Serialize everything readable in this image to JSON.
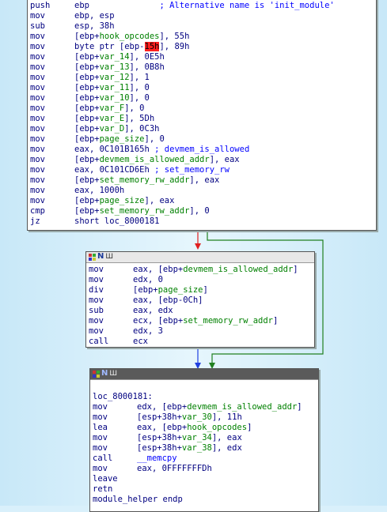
{
  "block1": {
    "lines": [
      {
        "m": "push",
        "parts": [
          {
            "t": "ebp",
            "c": "op"
          },
          {
            "t": "              ; Alternative name is 'init_module'",
            "c": "cmt"
          }
        ]
      },
      {
        "m": "mov",
        "parts": [
          {
            "t": "ebp, esp",
            "c": "op"
          }
        ]
      },
      {
        "m": "sub",
        "parts": [
          {
            "t": "esp, 38h",
            "c": "op"
          }
        ]
      },
      {
        "m": "mov",
        "parts": [
          {
            "t": "[ebp+",
            "c": "op"
          },
          {
            "t": "hook_opcodes",
            "c": "var"
          },
          {
            "t": "], 55h",
            "c": "op"
          }
        ]
      },
      {
        "m": "mov",
        "parts": [
          {
            "t": "byte ptr [ebp-",
            "c": "op"
          },
          {
            "t": "15h",
            "c": "hl"
          },
          {
            "t": "], 89h",
            "c": "op"
          }
        ]
      },
      {
        "m": "mov",
        "parts": [
          {
            "t": "[ebp+",
            "c": "op"
          },
          {
            "t": "var_14",
            "c": "var"
          },
          {
            "t": "], 0E5h",
            "c": "op"
          }
        ]
      },
      {
        "m": "mov",
        "parts": [
          {
            "t": "[ebp+",
            "c": "op"
          },
          {
            "t": "var_13",
            "c": "var"
          },
          {
            "t": "], 0B8h",
            "c": "op"
          }
        ]
      },
      {
        "m": "mov",
        "parts": [
          {
            "t": "[ebp+",
            "c": "op"
          },
          {
            "t": "var_12",
            "c": "var"
          },
          {
            "t": "], 1",
            "c": "op"
          }
        ]
      },
      {
        "m": "mov",
        "parts": [
          {
            "t": "[ebp+",
            "c": "op"
          },
          {
            "t": "var_11",
            "c": "var"
          },
          {
            "t": "], 0",
            "c": "op"
          }
        ]
      },
      {
        "m": "mov",
        "parts": [
          {
            "t": "[ebp+",
            "c": "op"
          },
          {
            "t": "var_10",
            "c": "var"
          },
          {
            "t": "], 0",
            "c": "op"
          }
        ]
      },
      {
        "m": "mov",
        "parts": [
          {
            "t": "[ebp+",
            "c": "op"
          },
          {
            "t": "var_F",
            "c": "var"
          },
          {
            "t": "], 0",
            "c": "op"
          }
        ]
      },
      {
        "m": "mov",
        "parts": [
          {
            "t": "[ebp+",
            "c": "op"
          },
          {
            "t": "var_E",
            "c": "var"
          },
          {
            "t": "], 5Dh",
            "c": "op"
          }
        ]
      },
      {
        "m": "mov",
        "parts": [
          {
            "t": "[ebp+",
            "c": "op"
          },
          {
            "t": "var_D",
            "c": "var"
          },
          {
            "t": "], 0C3h",
            "c": "op"
          }
        ]
      },
      {
        "m": "mov",
        "parts": [
          {
            "t": "[ebp+",
            "c": "op"
          },
          {
            "t": "page_size",
            "c": "var"
          },
          {
            "t": "], 0",
            "c": "op"
          }
        ]
      },
      {
        "m": "mov",
        "parts": [
          {
            "t": "eax, 0C101B165h ",
            "c": "op"
          },
          {
            "t": "; devmem_is_allowed",
            "c": "cmt"
          }
        ]
      },
      {
        "m": "mov",
        "parts": [
          {
            "t": "[ebp+",
            "c": "op"
          },
          {
            "t": "devmem_is_allowed_addr",
            "c": "var"
          },
          {
            "t": "], eax",
            "c": "op"
          }
        ]
      },
      {
        "m": "mov",
        "parts": [
          {
            "t": "eax, 0C101CD6Eh ",
            "c": "op"
          },
          {
            "t": "; set_memory_rw",
            "c": "cmt"
          }
        ]
      },
      {
        "m": "mov",
        "parts": [
          {
            "t": "[ebp+",
            "c": "op"
          },
          {
            "t": "set_memory_rw_addr",
            "c": "var"
          },
          {
            "t": "], eax",
            "c": "op"
          }
        ]
      },
      {
        "m": "mov",
        "parts": [
          {
            "t": "eax, 1000h",
            "c": "op"
          }
        ]
      },
      {
        "m": "mov",
        "parts": [
          {
            "t": "[ebp+",
            "c": "op"
          },
          {
            "t": "page_size",
            "c": "var"
          },
          {
            "t": "], eax",
            "c": "op"
          }
        ]
      },
      {
        "m": "cmp",
        "parts": [
          {
            "t": "[ebp+",
            "c": "op"
          },
          {
            "t": "set_memory_rw_addr",
            "c": "var"
          },
          {
            "t": "], 0",
            "c": "op"
          }
        ]
      },
      {
        "m": "jz",
        "parts": [
          {
            "t": "short loc_8000181",
            "c": "op"
          }
        ]
      }
    ]
  },
  "block2": {
    "lines": [
      {
        "m": "mov",
        "parts": [
          {
            "t": "eax, [ebp+",
            "c": "op"
          },
          {
            "t": "devmem_is_allowed_addr",
            "c": "var"
          },
          {
            "t": "]",
            "c": "op"
          }
        ]
      },
      {
        "m": "mov",
        "parts": [
          {
            "t": "edx, 0",
            "c": "op"
          }
        ]
      },
      {
        "m": "div",
        "parts": [
          {
            "t": "[ebp+",
            "c": "op"
          },
          {
            "t": "page_size",
            "c": "var"
          },
          {
            "t": "]",
            "c": "op"
          }
        ]
      },
      {
        "m": "mov",
        "parts": [
          {
            "t": "eax, [ebp-0Ch]",
            "c": "op"
          }
        ]
      },
      {
        "m": "sub",
        "parts": [
          {
            "t": "eax, edx",
            "c": "op"
          }
        ]
      },
      {
        "m": "mov",
        "parts": [
          {
            "t": "ecx, [ebp+",
            "c": "op"
          },
          {
            "t": "set_memory_rw_addr",
            "c": "var"
          },
          {
            "t": "]",
            "c": "op"
          }
        ]
      },
      {
        "m": "mov",
        "parts": [
          {
            "t": "edx, 3",
            "c": "op"
          }
        ]
      },
      {
        "m": "call",
        "parts": [
          {
            "t": "ecx",
            "c": "op"
          }
        ]
      }
    ]
  },
  "block3": {
    "label": "loc_8000181:",
    "lines": [
      {
        "m": "mov",
        "parts": [
          {
            "t": "edx, [ebp+",
            "c": "op"
          },
          {
            "t": "devmem_is_allowed_addr",
            "c": "var"
          },
          {
            "t": "]",
            "c": "op"
          }
        ]
      },
      {
        "m": "mov",
        "parts": [
          {
            "t": "[esp+38h+",
            "c": "op"
          },
          {
            "t": "var_30",
            "c": "var"
          },
          {
            "t": "], 11h",
            "c": "op"
          }
        ]
      },
      {
        "m": "lea",
        "parts": [
          {
            "t": "eax, [ebp+",
            "c": "op"
          },
          {
            "t": "hook_opcodes",
            "c": "var"
          },
          {
            "t": "]",
            "c": "op"
          }
        ]
      },
      {
        "m": "mov",
        "parts": [
          {
            "t": "[esp+38h+",
            "c": "op"
          },
          {
            "t": "var_34",
            "c": "var"
          },
          {
            "t": "], eax",
            "c": "op"
          }
        ]
      },
      {
        "m": "mov",
        "parts": [
          {
            "t": "[esp+38h+",
            "c": "op"
          },
          {
            "t": "var_38",
            "c": "var"
          },
          {
            "t": "], edx",
            "c": "op"
          }
        ]
      },
      {
        "m": "call",
        "parts": [
          {
            "t": "__memcpy",
            "c": "cmt"
          }
        ]
      },
      {
        "m": "mov",
        "parts": [
          {
            "t": "eax, 0FFFFFFFDh",
            "c": "op"
          }
        ]
      },
      {
        "m": "leave",
        "parts": []
      },
      {
        "m": "retn",
        "parts": []
      },
      {
        "m": "module_helper endp",
        "parts": []
      }
    ]
  },
  "header_icons": {
    "grid": "graph-icon",
    "n": "N",
    "bars": "Ш"
  },
  "colors": {
    "false_edge": "#e02020",
    "true_edge": "#208020",
    "flow_edge": "#2040e0"
  }
}
